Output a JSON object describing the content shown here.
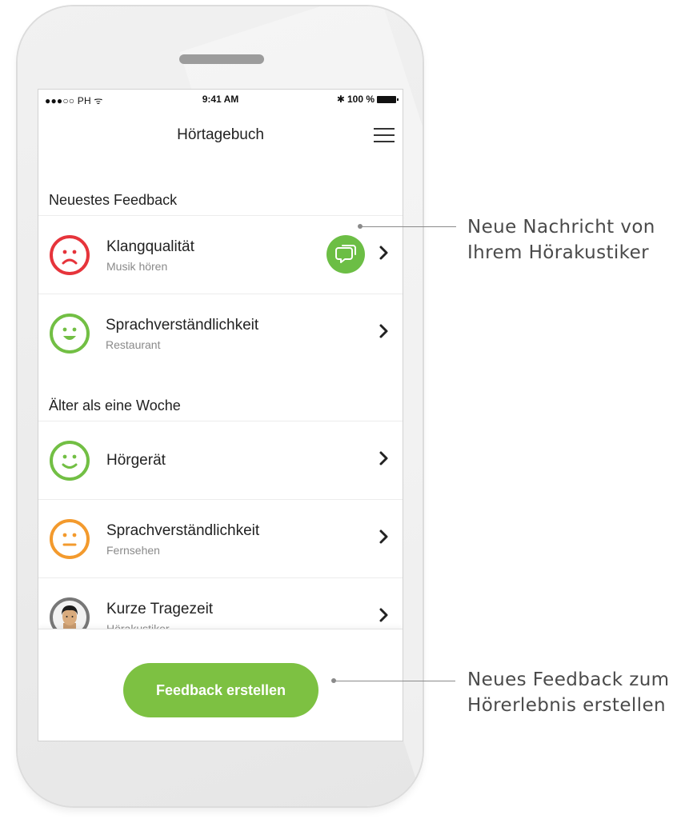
{
  "status_bar": {
    "carrier": "●●●○○ PH ᯤ",
    "time": "9:41 AM",
    "bluetooth": "✱",
    "battery": "100 %"
  },
  "nav": {
    "title": "Hörtagebuch",
    "menu_icon": "hamburger-menu-icon"
  },
  "sections": {
    "recent": {
      "title": "Neuestes Feedback"
    },
    "older": {
      "title": "Älter als eine Woche"
    }
  },
  "items": [
    {
      "label": "Klangqualität",
      "sub": "Musik hören",
      "icon": "sad-face-icon",
      "color": "#e6343b",
      "has_message": true
    },
    {
      "label": "Sprachverständlichkeit",
      "sub": "Restaurant",
      "icon": "happy-face-icon",
      "color": "#72bf44"
    },
    {
      "label": "Hörgerät",
      "sub": "",
      "icon": "smile-face-icon",
      "color": "#72bf44"
    },
    {
      "label": "Sprachverständlichkeit",
      "sub": "Fernsehen",
      "icon": "neutral-face-icon",
      "color": "#f39a2d"
    },
    {
      "label": "Kurze Tragezeit",
      "sub": "Hörakustiker",
      "icon": "audiologist-avatar-icon",
      "color": "#777777"
    }
  ],
  "cta": {
    "label": "Feedback erstellen",
    "color": "#7dc142"
  },
  "annotations": {
    "message": {
      "line1": "Neue Nachricht von",
      "line2": "Ihrem Hörakustiker"
    },
    "feedback": {
      "line1": "Neues Feedback zum",
      "line2": "Hörerlebnis erstellen"
    }
  }
}
